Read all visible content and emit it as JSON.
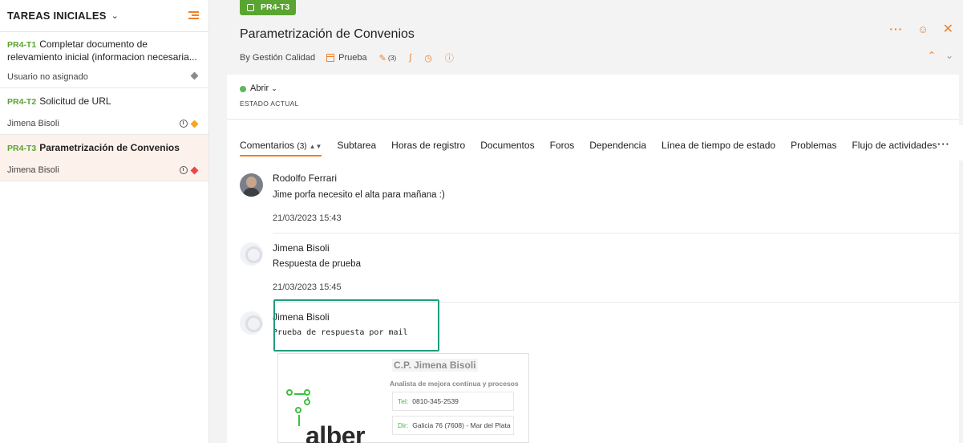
{
  "sidebar": {
    "title": "TAREAS INICIALES",
    "tasks": [
      {
        "code": "PR4-T1",
        "name_line1": "Completar documento de",
        "name_line2": "relevamiento inicial (informacion necesaria...",
        "assignee": "Usuario no asignado",
        "priority_color": "#8a8a8a"
      },
      {
        "code": "PR4-T2",
        "name": "Solicitud de URL",
        "assignee": "Jimena Bisoli",
        "priority_color": "#f5a623"
      },
      {
        "code": "PR4-T3",
        "name": "Parametrización de Convenios",
        "assignee": "Jimena Bisoli",
        "priority_color": "#e8474c"
      }
    ]
  },
  "task": {
    "badge": "PR4-T3",
    "title": "Parametrización de Convenios",
    "by": "By Gestión Calidad",
    "list_name": "Prueba",
    "comment_count": "(3)",
    "status": "Abrir",
    "status_label": "ESTADO ACTUAL"
  },
  "tabs": [
    {
      "label": "Comentarios",
      "count": "(3)"
    },
    {
      "label": "Subtarea"
    },
    {
      "label": "Horas de registro"
    },
    {
      "label": "Documentos"
    },
    {
      "label": "Foros"
    },
    {
      "label": "Dependencia"
    },
    {
      "label": "Línea de tiempo de estado"
    },
    {
      "label": "Problemas"
    },
    {
      "label": "Flujo de actividades"
    }
  ],
  "comments": [
    {
      "author": "Rodolfo Ferrari",
      "text": "Jime porfa necesito el alta para mañana :)",
      "date": "21/03/2023 15:43"
    },
    {
      "author": "Jimena Bisoli",
      "text": "Respuesta de prueba",
      "date": "21/03/2023 15:45"
    },
    {
      "author": "Jimena Bisoli",
      "text": "Prueba de respuesta por mail"
    }
  ],
  "signature": {
    "brand": "alber",
    "name": "C.P. Jimena Bisoli",
    "role": "Analista de mejora continua y procesos",
    "tel_key": "Tel:",
    "tel": "0810-345-2539",
    "dir_key": "Dir:",
    "dir": "Galicia 76 (7608) - Mar del Plata"
  },
  "colors": {
    "accent": "#f07f26",
    "badge": "#5aa531",
    "status_open": "#5cb85c",
    "highlight": "#1f9e7d"
  }
}
